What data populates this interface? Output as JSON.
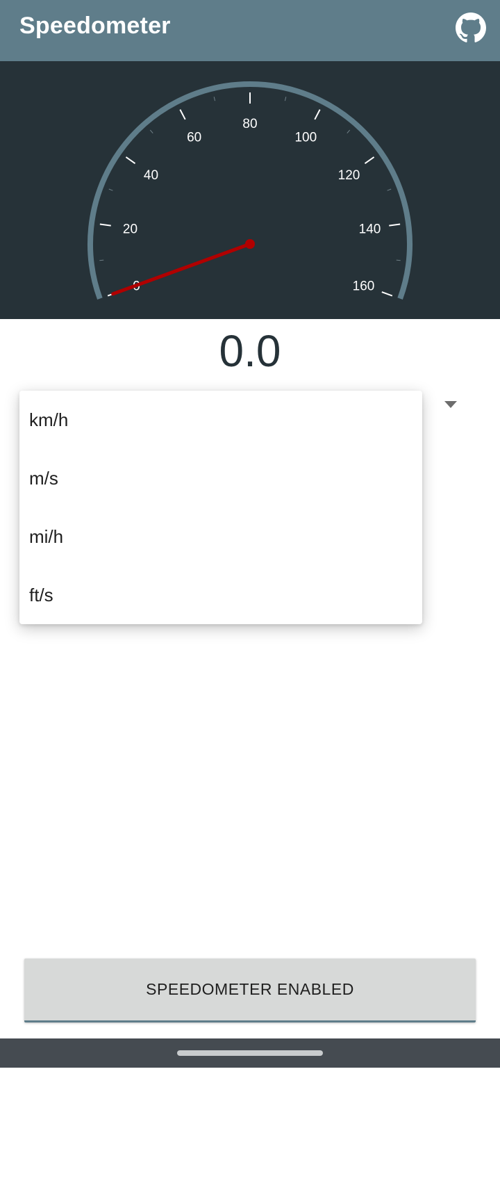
{
  "app_bar": {
    "title": "Speedometer",
    "icon": "github-icon",
    "background": "#5f7d8a"
  },
  "gauge": {
    "min": 0,
    "max": 160,
    "major_step": 20,
    "minor_step": 10,
    "labels": [
      "0",
      "20",
      "40",
      "60",
      "80",
      "100",
      "120",
      "140",
      "160"
    ],
    "current_speed": 0,
    "arc_color": "#5f7d8a",
    "needle_color": "#b00000",
    "background": "#263238"
  },
  "speed_readout": "0.0",
  "unit_dropdown": {
    "options": [
      "km/h",
      "m/s",
      "mi/h",
      "ft/s"
    ]
  },
  "enable_button": {
    "label": "SPEEDOMETER ENABLED"
  }
}
